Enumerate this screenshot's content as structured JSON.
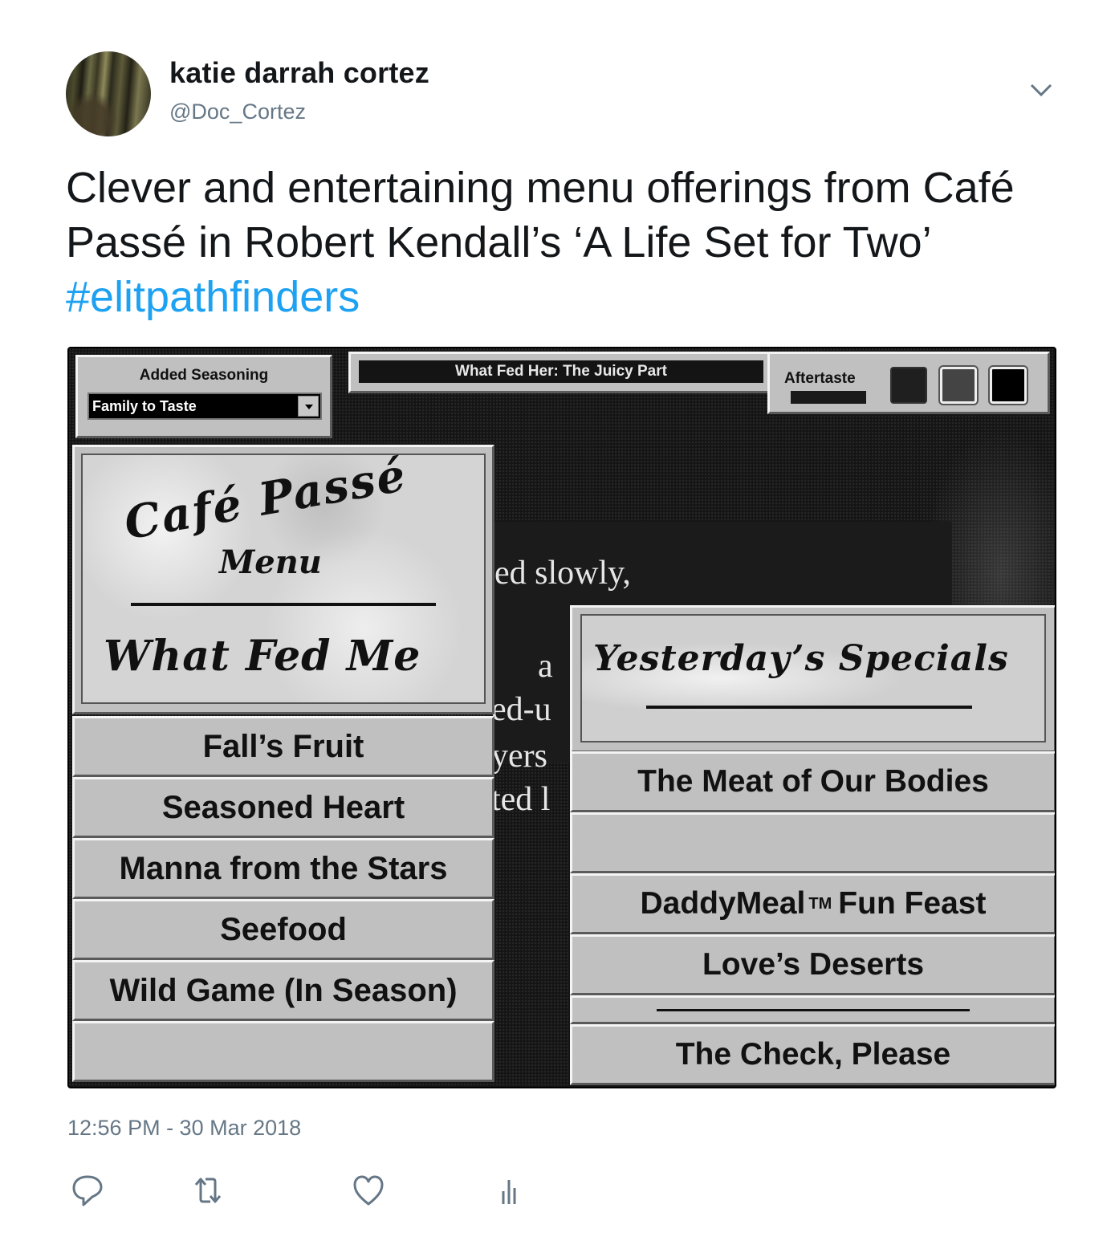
{
  "tweet": {
    "author_name": "katie darrah cortez",
    "author_handle": "@Doc_Cortez",
    "text": "Clever and entertaining menu offerings from Café Passé in Robert Kendall’s ‘A Life Set for Two’ ",
    "hashtag": "#elitpathfinders",
    "timestamp": "12:56 PM - 30 Mar 2018",
    "icons": {
      "menu": "chevron-down-icon",
      "reply": "reply-icon",
      "retweet": "retweet-icon",
      "like": "heart-icon",
      "analytics": "analytics-icon"
    }
  },
  "screenshot": {
    "seasoning": {
      "label": "Added Seasoning",
      "selected": "Family to Taste"
    },
    "title_bar": "What Fed Her: The Juicy Part",
    "aftertaste": {
      "label": "Aftertaste",
      "swatches": [
        "#1f1f1f",
        "#444444",
        "#000000"
      ]
    },
    "menu_card": {
      "line1": "Café Passé",
      "line2": "Menu",
      "line3": "What Fed Me"
    },
    "left_menu": [
      {
        "label": "Fall’s Fruit"
      },
      {
        "label": "Seasoned Heart"
      },
      {
        "label": "Manna from the Stars"
      },
      {
        "label": "Seefood"
      },
      {
        "label": "Wild Game (In Season)"
      },
      {
        "label": ""
      }
    ],
    "background_text": {
      "line1": "ed slowly,",
      "line2": "a",
      "line3": "ed-u",
      "line4": "yers",
      "line5": "ted l"
    },
    "specials": {
      "title": "Yesterday’s Specials"
    },
    "right_menu": {
      "item1": "The Meat of Our Bodies",
      "item2": "",
      "item3_prefix": "DaddyMeal",
      "item3_tm": "TM",
      "item3_suffix": "Fun Feast",
      "item4": "Love’s Deserts",
      "item6": "The Check, Please"
    }
  }
}
